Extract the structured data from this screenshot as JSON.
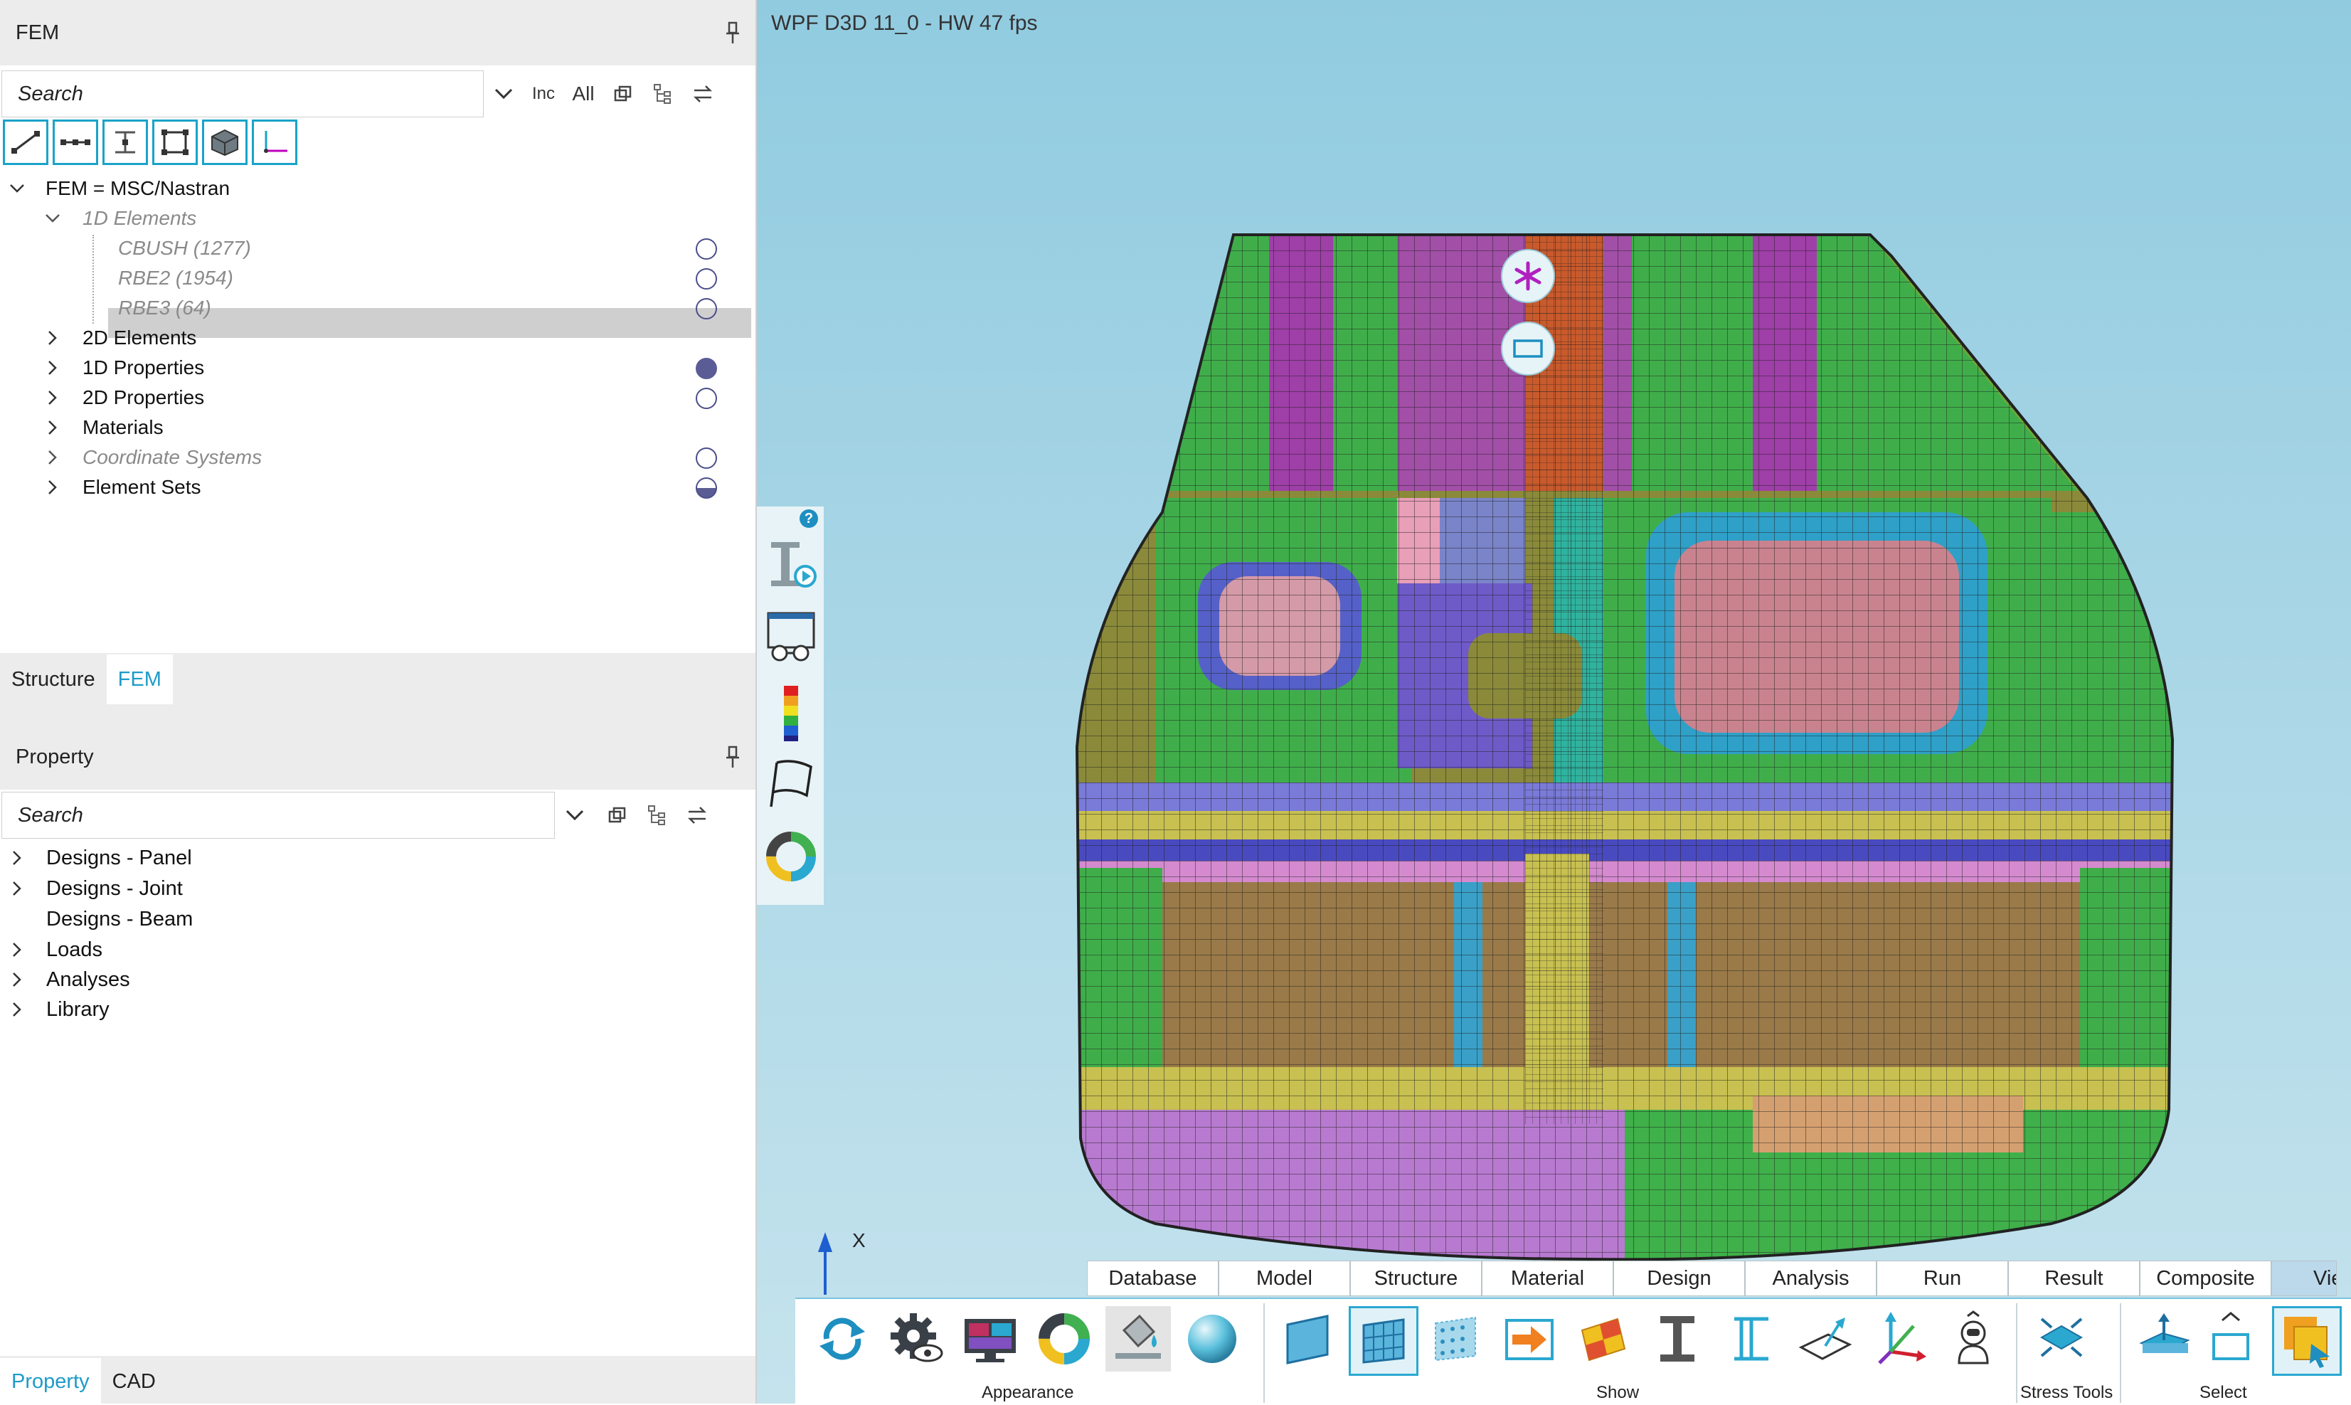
{
  "fem_panel": {
    "title": "FEM",
    "search_placeholder": "Search",
    "filters": {
      "inc": "Inc",
      "all": "All"
    },
    "tree": [
      {
        "label": "FEM = MSC/Nastran",
        "level": 0,
        "expanded": true,
        "style": "normal"
      },
      {
        "label": "1D Elements",
        "level": 1,
        "expanded": true,
        "style": "dim"
      },
      {
        "label": "CBUSH (1277)",
        "level": 2,
        "style": "dim",
        "indicator": "empty"
      },
      {
        "label": "RBE2 (1954)",
        "level": 2,
        "style": "dim",
        "indicator": "empty"
      },
      {
        "label": "RBE3 (64)",
        "level": 2,
        "style": "dim",
        "indicator": "empty",
        "selected": true
      },
      {
        "label": "2D Elements",
        "level": 1,
        "collapsed": true,
        "style": "normal"
      },
      {
        "label": "1D Properties",
        "level": 1,
        "collapsed": true,
        "style": "normal",
        "indicator": "full"
      },
      {
        "label": "2D Properties",
        "level": 1,
        "collapsed": true,
        "style": "normal",
        "indicator": "empty"
      },
      {
        "label": "Materials",
        "level": 1,
        "collapsed": true,
        "style": "normal"
      },
      {
        "label": "Coordinate Systems",
        "level": 1,
        "collapsed": true,
        "style": "dim",
        "indicator": "empty"
      },
      {
        "label": "Element Sets",
        "level": 1,
        "collapsed": true,
        "style": "normal",
        "indicator": "half"
      }
    ],
    "tabs": [
      "Structure",
      "FEM"
    ],
    "active_tab": "FEM"
  },
  "property_panel": {
    "title": "Property",
    "search_placeholder": "Search",
    "tree": [
      {
        "label": "Designs - Panel",
        "chevron": true
      },
      {
        "label": "Designs - Joint",
        "chevron": true
      },
      {
        "label": "Designs - Beam",
        "chevron": false
      },
      {
        "label": "Loads",
        "chevron": true
      },
      {
        "label": "Analyses",
        "chevron": true
      },
      {
        "label": "Library",
        "chevron": true
      }
    ],
    "tabs": [
      "Property",
      "CAD"
    ],
    "active_tab": "Property"
  },
  "viewport": {
    "title": "WPF D3D 11_0 - HW  47  fps",
    "axis_label": "X",
    "help_badge": "?"
  },
  "ribbon": {
    "tabs": [
      "Database",
      "Model",
      "Structure",
      "Material",
      "Design",
      "Analysis",
      "Run",
      "Result",
      "Composite",
      "Vie"
    ],
    "active_tab": "Vie",
    "groups": {
      "appearance": "Appearance",
      "show": "Show",
      "stress_tools": "Stress Tools",
      "select": "Select"
    }
  },
  "colors": {
    "accent": "#1e9bc8",
    "indicator": "#5a5c95",
    "viewport_top": "#91cbe0"
  }
}
